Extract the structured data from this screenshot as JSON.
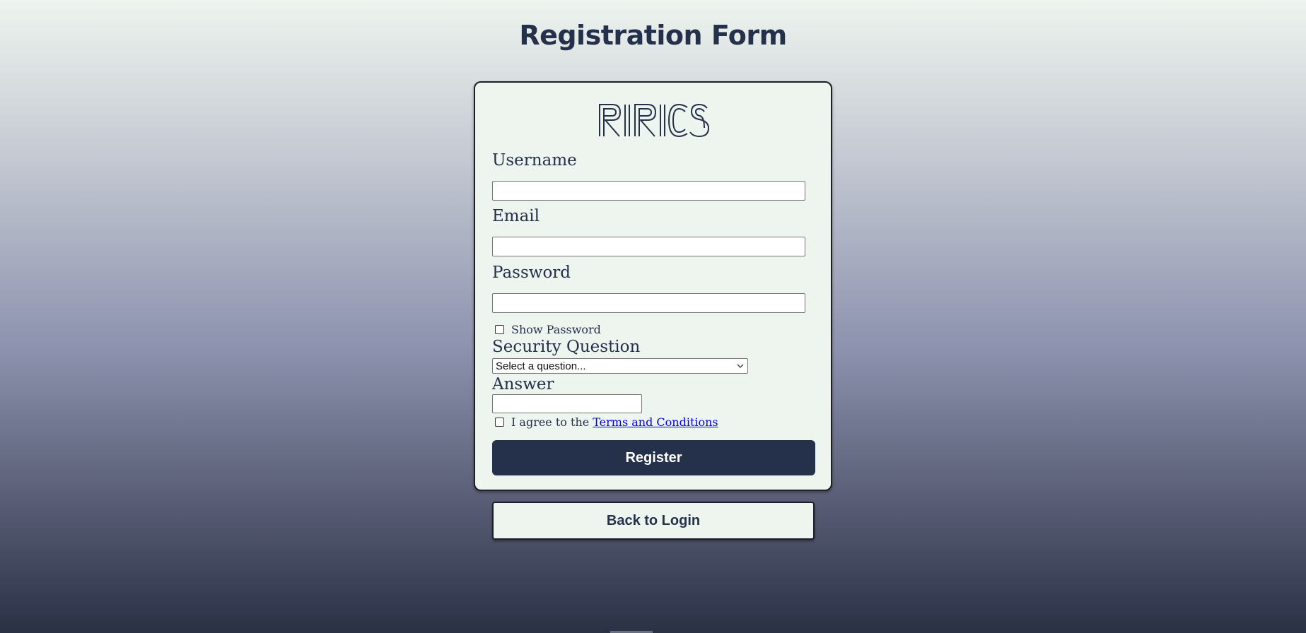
{
  "page": {
    "title": "Registration Form"
  },
  "logo": {
    "text": "RIRICS"
  },
  "form": {
    "username_label": "Username",
    "username_value": "",
    "email_label": "Email",
    "email_value": "",
    "password_label": "Password",
    "password_value": "",
    "show_password_label": "Show Password",
    "show_password_checked": false,
    "security_question_label": "Security Question",
    "security_question_selected": "Select a question...",
    "answer_label": "Answer",
    "answer_value": "",
    "agree_prefix": "I agree to the",
    "terms_link": "Terms and Conditions",
    "agree_checked": false,
    "register_label": "Register"
  },
  "back_to_login_label": "Back to Login",
  "colors": {
    "primary": "#25304a",
    "card_bg": "#eef4ee",
    "link": "#0000ee"
  }
}
